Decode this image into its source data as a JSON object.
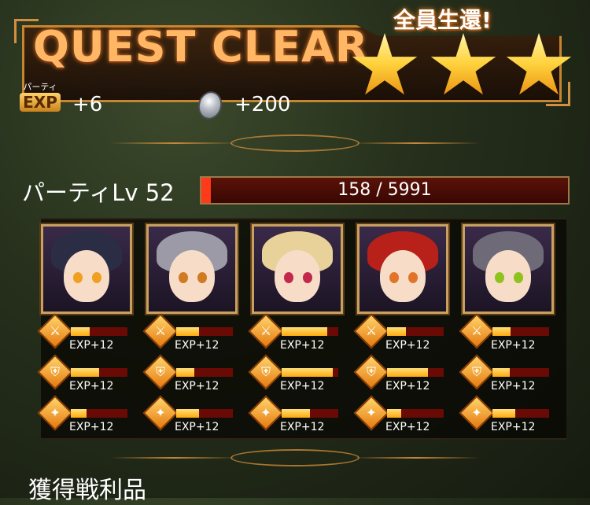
{
  "banner": {
    "title": "QUEST CLEAR",
    "subtitle": "全員生還!",
    "stars_earned": 3,
    "stars_total": 3
  },
  "rewards": {
    "party_exp_small_label": "パーティ",
    "party_exp_badge": "EXP",
    "party_exp_value": "+6",
    "coin_value": "+200"
  },
  "party": {
    "level_label": "パーティLv 52",
    "exp_text": "158 / 5991",
    "exp_fraction": 0.026
  },
  "characters": [
    {
      "hair": "#2b2d45",
      "eye": "#f0a020",
      "stats": [
        {
          "label": "EXP+12",
          "fill": 0.33
        },
        {
          "label": "EXP+12",
          "fill": 0.5
        },
        {
          "label": "EXP+12",
          "fill": 0.28
        }
      ]
    },
    {
      "hair": "#9c9aa6",
      "eye": "#d07a22",
      "stats": [
        {
          "label": "EXP+12",
          "fill": 0.4
        },
        {
          "label": "EXP+12",
          "fill": 0.32
        },
        {
          "label": "EXP+12",
          "fill": 0.4
        }
      ]
    },
    {
      "hair": "#e9d29a",
      "eye": "#c2284a",
      "stats": [
        {
          "label": "EXP+12",
          "fill": 0.8
        },
        {
          "label": "EXP+12",
          "fill": 0.9
        },
        {
          "label": "EXP+12",
          "fill": 0.5
        }
      ]
    },
    {
      "hair": "#b8201a",
      "eye": "#e2742a",
      "stats": [
        {
          "label": "EXP+12",
          "fill": 0.33
        },
        {
          "label": "EXP+12",
          "fill": 0.72
        },
        {
          "label": "EXP+12",
          "fill": 0.25
        }
      ]
    },
    {
      "hair": "#6f6a78",
      "eye": "#8ec21d",
      "stats": [
        {
          "label": "EXP+12",
          "fill": 0.32
        },
        {
          "label": "EXP+12",
          "fill": 0.3
        },
        {
          "label": "EXP+12",
          "fill": 0.4
        }
      ]
    }
  ],
  "stat_icons": [
    "sword-icon",
    "armor-icon",
    "scroll-icon"
  ],
  "loot_heading": "獲得戦利品",
  "colors": {
    "accent": "#c7852f",
    "title": "#ffb766",
    "bar_fill": "#ffaa0e",
    "party_bar": "#ff3a1a"
  }
}
